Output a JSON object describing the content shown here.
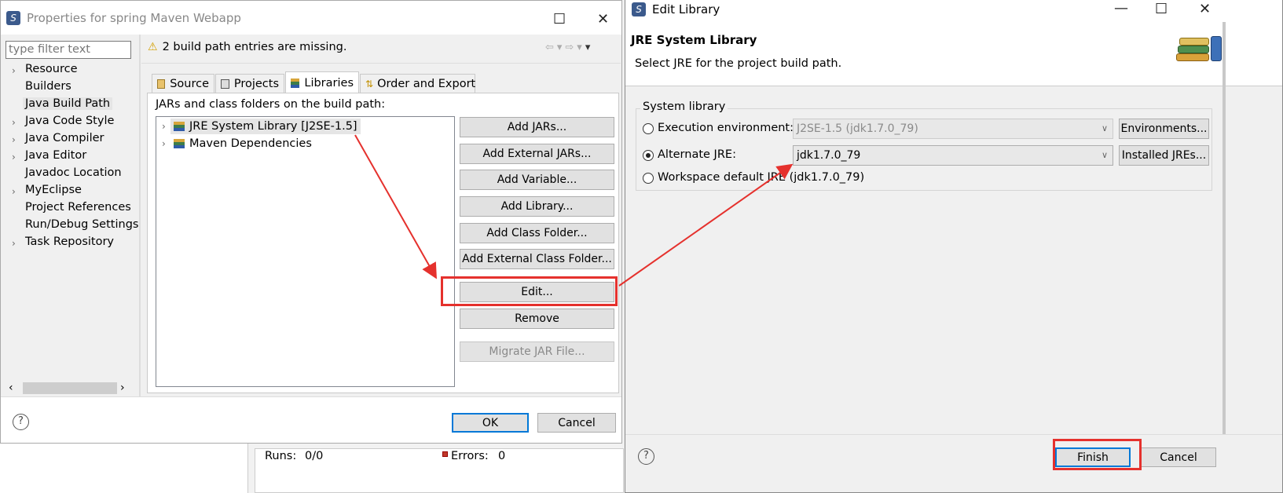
{
  "props": {
    "title": "Properties for spring Maven Webapp",
    "filter_placeholder": "type filter text",
    "nav": [
      {
        "label": "Resource",
        "expandable": true
      },
      {
        "label": "Builders",
        "expandable": false
      },
      {
        "label": "Java Build Path",
        "expandable": false,
        "selected": true
      },
      {
        "label": "Java Code Style",
        "expandable": true
      },
      {
        "label": "Java Compiler",
        "expandable": true
      },
      {
        "label": "Java Editor",
        "expandable": true
      },
      {
        "label": "Javadoc Location",
        "expandable": false
      },
      {
        "label": "MyEclipse",
        "expandable": true
      },
      {
        "label": "Project References",
        "expandable": false
      },
      {
        "label": "Run/Debug Settings",
        "expandable": false
      },
      {
        "label": "Task Repository",
        "expandable": true
      }
    ],
    "warning": "2 build path entries are missing.",
    "tabs": [
      "Source",
      "Projects",
      "Libraries",
      "Order and Export"
    ],
    "list_label": "JARs and class folders on the build path:",
    "entries": [
      "JRE System Library [J2SE-1.5]",
      "Maven Dependencies"
    ],
    "buttons": [
      "Add JARs...",
      "Add External JARs...",
      "Add Variable...",
      "Add Library...",
      "Add Class Folder...",
      "Add External Class Folder...",
      "Edit...",
      "Remove",
      "Migrate JAR File..."
    ],
    "ok": "OK",
    "cancel": "Cancel"
  },
  "status": {
    "runs_label": "Runs:",
    "runs_value": "0/0",
    "errors_label": "Errors:",
    "errors_value": "0"
  },
  "edit": {
    "title": "Edit Library",
    "heading": "JRE System Library",
    "desc": "Select JRE for the project build path.",
    "group": "System library",
    "exec_env_label": "Execution environment:",
    "exec_env_value": "J2SE-1.5 (jdk1.7.0_79)",
    "environments_btn": "Environments...",
    "alt_jre_label": "Alternate JRE:",
    "alt_jre_value": "jdk1.7.0_79",
    "installed_btn": "Installed JREs...",
    "workspace_label": "Workspace default JRE (jdk1.7.0_79)",
    "finish": "Finish",
    "cancel": "Cancel"
  },
  "colors": {
    "annotation": "#e5312d",
    "selection": "#cce8ff",
    "accent": "#0078d7"
  }
}
